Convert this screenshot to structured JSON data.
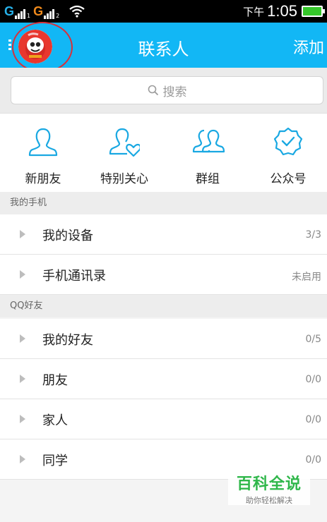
{
  "status_bar": {
    "sim1": "G",
    "sim1_index": "1",
    "sim2": "G",
    "sim2_index": "2",
    "time_prefix": "下午",
    "time": "1:05",
    "battery_color": "#35c72a"
  },
  "title_bar": {
    "title": "联系人",
    "add_label": "添加",
    "bg_color": "#12b7f5",
    "avatar_highlight_color": "#d8303a"
  },
  "search": {
    "placeholder": "搜索"
  },
  "quick_entries": [
    {
      "label": "新朋友",
      "icon": "new-friend-icon"
    },
    {
      "label": "特别关心",
      "icon": "special-care-icon"
    },
    {
      "label": "群组",
      "icon": "group-icon"
    },
    {
      "label": "公众号",
      "icon": "official-account-icon"
    }
  ],
  "sections": [
    {
      "header": "我的手机",
      "rows": [
        {
          "name": "我的设备",
          "count": "3/3"
        },
        {
          "name": "手机通讯录",
          "count": "未启用"
        }
      ]
    },
    {
      "header": "QQ好友",
      "rows": [
        {
          "name": "我的好友",
          "count": "0/5"
        },
        {
          "name": "朋友",
          "count": "0/0"
        },
        {
          "name": "家人",
          "count": "0/0"
        },
        {
          "name": "同学",
          "count": "0/0"
        }
      ]
    }
  ],
  "watermark": {
    "title": "百科全说",
    "subtitle": "助你轻松解决",
    "color": "#2fb74a"
  }
}
